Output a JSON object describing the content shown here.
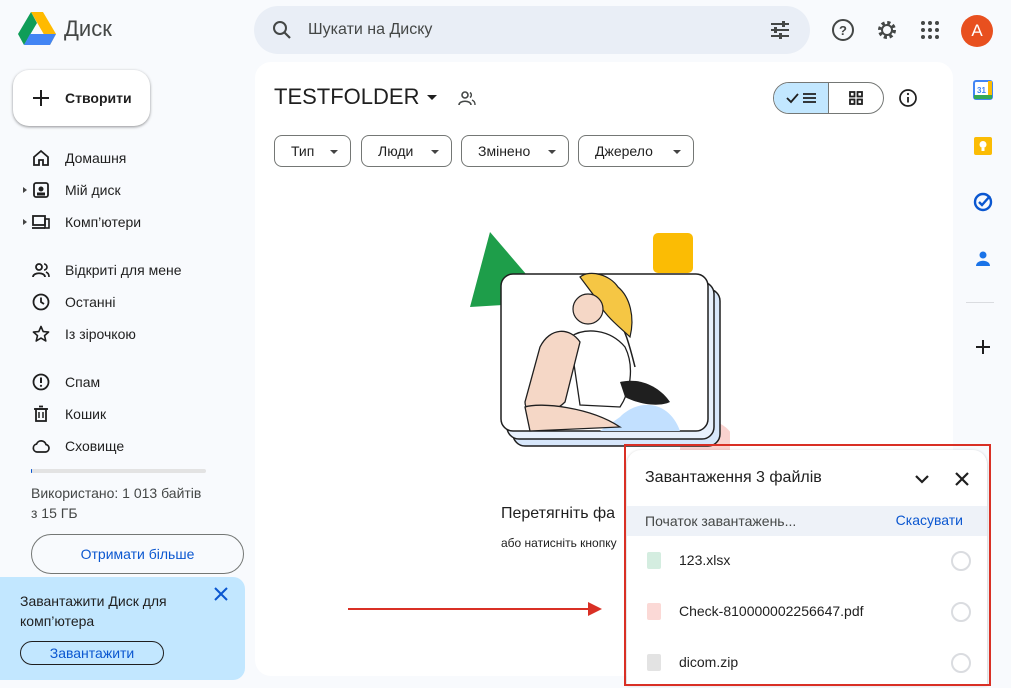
{
  "app": {
    "name": "Диск",
    "avatar_letter": "A"
  },
  "search": {
    "placeholder": "Шукати на Диску"
  },
  "sidebar": {
    "new_label": "Створити",
    "items": [
      {
        "label": "Домашня",
        "icon": "home-icon"
      },
      {
        "label": "Мій диск",
        "icon": "my-drive-icon"
      },
      {
        "label": "Комп’ютери",
        "icon": "computers-icon"
      },
      {
        "label": "Відкриті для мене",
        "icon": "shared-icon"
      },
      {
        "label": "Останні",
        "icon": "clock-icon"
      },
      {
        "label": "Із зірочкою",
        "icon": "star-icon"
      },
      {
        "label": "Спам",
        "icon": "spam-icon"
      },
      {
        "label": "Кошик",
        "icon": "trash-icon"
      },
      {
        "label": "Сховище",
        "icon": "cloud-icon"
      }
    ],
    "storage_line1": "Використано: 1 013 байтів",
    "storage_line2": "з 15 ГБ",
    "storage_used_fraction": 0.0,
    "get_more_label": "Отримати більше",
    "promo_text": "Завантажити Диск для комп’ютера",
    "promo_button": "Завантажити"
  },
  "main": {
    "folder_title": "TESTFOLDER",
    "filters": [
      "Тип",
      "Люди",
      "Змінено",
      "Джерело"
    ],
    "empty_title": "Перетягніть фа",
    "empty_subtitle": "або натисніть кнопку"
  },
  "upload": {
    "title": "Завантаження 3 файлів",
    "status": "Початок завантажень...",
    "cancel": "Скасувати",
    "files": [
      {
        "name": "123.xlsx",
        "type": "xlsx",
        "icon_color": "#d4ede0"
      },
      {
        "name": "Check-810000002256647.pdf",
        "type": "pdf",
        "icon_color": "#fbd9d6"
      },
      {
        "name": "dicom.zip",
        "type": "zip",
        "icon_color": "#e3e3e3"
      }
    ]
  },
  "colors": {
    "accent": "#0b57d0",
    "highlight": "#c2e7ff",
    "annotation_red": "#d93025",
    "avatar": "#e8501f"
  }
}
